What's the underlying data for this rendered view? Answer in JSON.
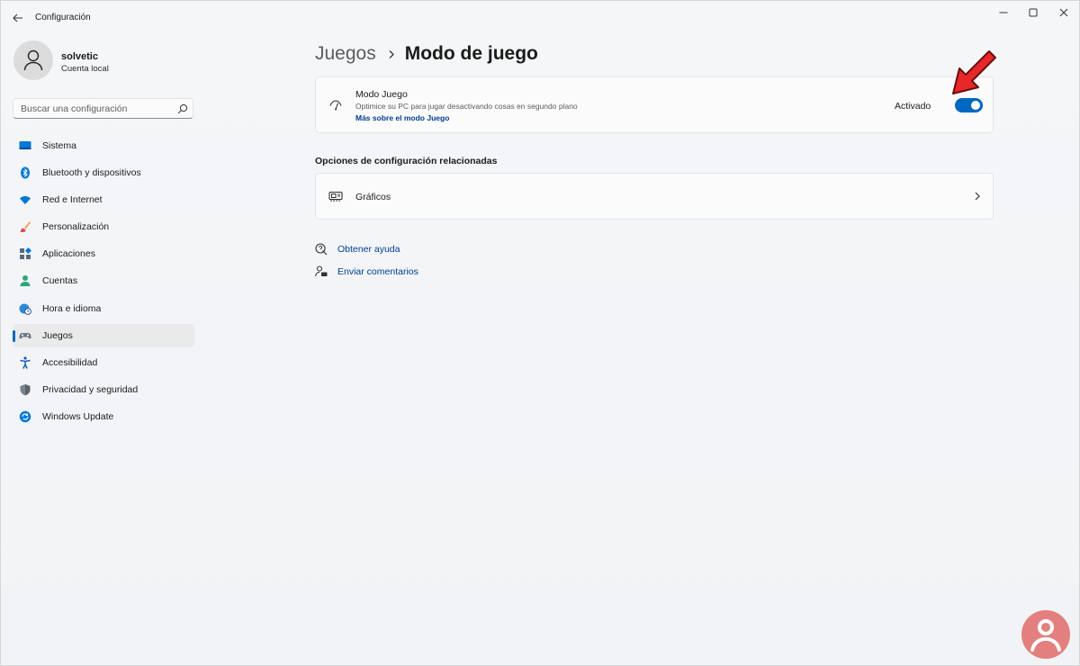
{
  "window": {
    "title": "Configuración"
  },
  "profile": {
    "name": "solvetic",
    "account_type": "Cuenta local"
  },
  "search": {
    "placeholder": "Buscar una configuración",
    "value": ""
  },
  "sidebar": {
    "items": [
      {
        "label": "Sistema",
        "icon": "system-icon",
        "active": false
      },
      {
        "label": "Bluetooth y dispositivos",
        "icon": "bluetooth-icon",
        "active": false
      },
      {
        "label": "Red e Internet",
        "icon": "wifi-icon",
        "active": false
      },
      {
        "label": "Personalización",
        "icon": "brush-icon",
        "active": false
      },
      {
        "label": "Aplicaciones",
        "icon": "apps-icon",
        "active": false
      },
      {
        "label": "Cuentas",
        "icon": "person-icon",
        "active": false
      },
      {
        "label": "Hora e idioma",
        "icon": "globe-clock-icon",
        "active": false
      },
      {
        "label": "Juegos",
        "icon": "gamepad-icon",
        "active": true
      },
      {
        "label": "Accesibilidad",
        "icon": "accessibility-icon",
        "active": false
      },
      {
        "label": "Privacidad y seguridad",
        "icon": "shield-icon",
        "active": false
      },
      {
        "label": "Windows Update",
        "icon": "update-icon",
        "active": false
      }
    ]
  },
  "main": {
    "breadcrumb": {
      "parent": "Juegos",
      "current": "Modo de juego"
    },
    "game_mode": {
      "title": "Modo Juego",
      "description": "Optimice su PC para jugar desactivando cosas en segundo plano",
      "link": "Más sobre el modo Juego",
      "state_label": "Activado",
      "enabled": true
    },
    "related": {
      "title": "Opciones de configuración relacionadas",
      "graphics_label": "Gráficos"
    },
    "help": {
      "get_help": "Obtener ayuda",
      "feedback": "Enviar comentarios"
    }
  },
  "colors": {
    "accent": "#0067c0",
    "link": "#003e92",
    "annotation_arrow": "#e8272b"
  }
}
